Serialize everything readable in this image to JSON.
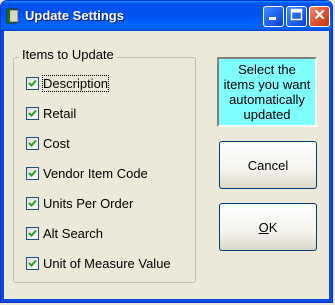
{
  "window": {
    "title": "Update Settings",
    "icon": "book-icon",
    "controls": {
      "minimize": "minimize-icon",
      "maximize": "maximize-icon",
      "close": "close-icon"
    }
  },
  "group": {
    "label": "Items to Update",
    "items": [
      {
        "label": "Description",
        "checked": true,
        "focused": true
      },
      {
        "label": "Retail",
        "checked": true
      },
      {
        "label": "Cost",
        "checked": true
      },
      {
        "label": "Vendor Item Code",
        "checked": true
      },
      {
        "label": "Units Per Order",
        "checked": true
      },
      {
        "label": "Alt Search",
        "checked": true
      },
      {
        "label": "Unit of Measure Value",
        "checked": true
      }
    ]
  },
  "info": {
    "text": "Select the items you want automatically updated",
    "background": "#80ffff"
  },
  "buttons": {
    "cancel_label": "Cancel",
    "ok_mnemonic": "O",
    "ok_rest": "K"
  }
}
